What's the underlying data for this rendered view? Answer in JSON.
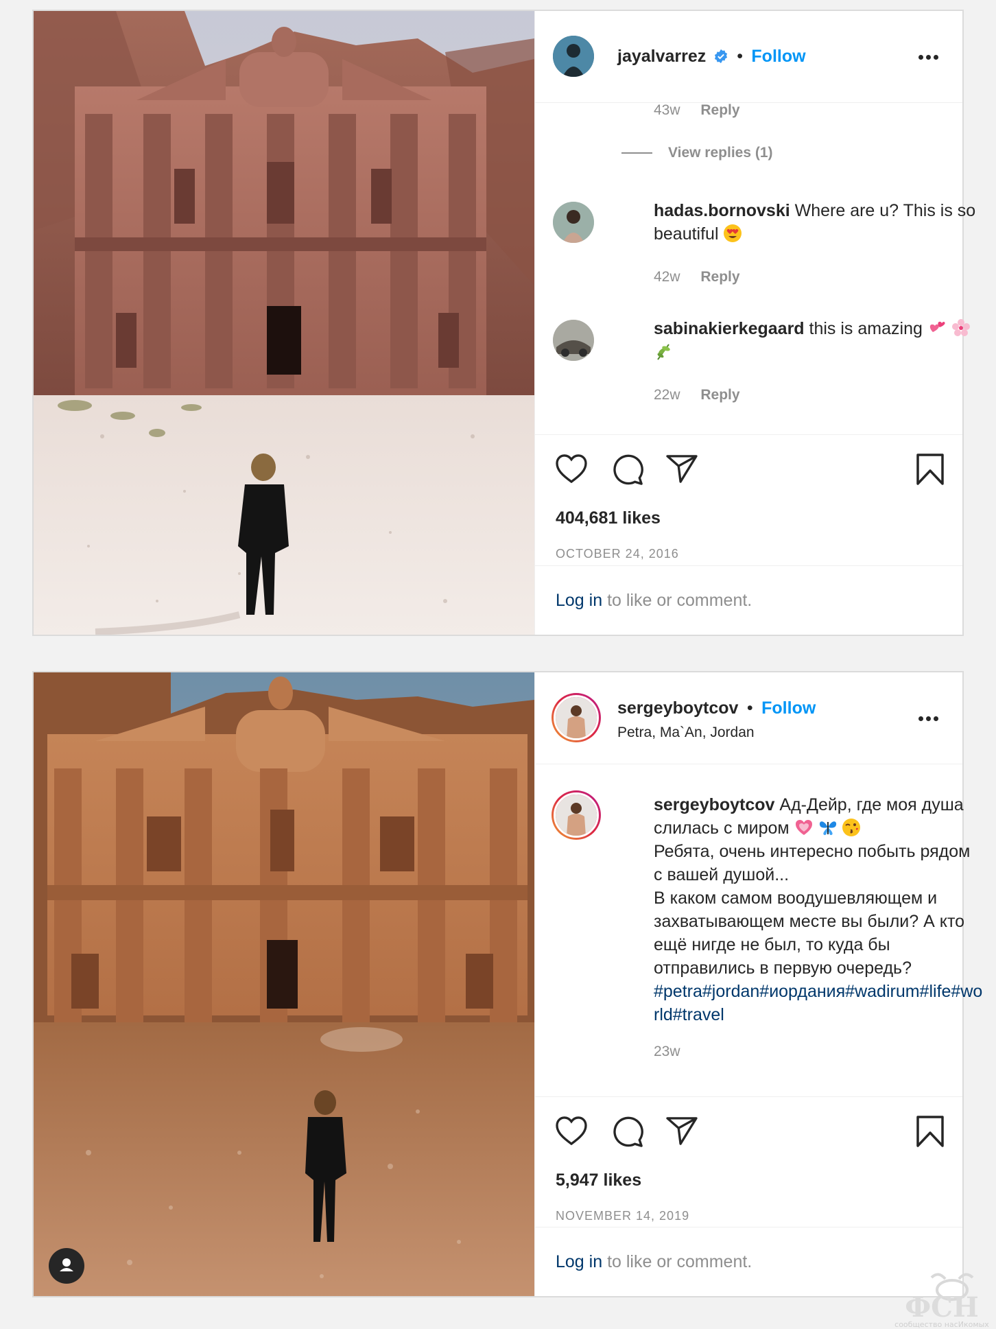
{
  "post1": {
    "username": "jayalvarrez",
    "follow_label": "Follow",
    "separator": "•",
    "comments": [
      {
        "time": "43w",
        "reply": "Reply"
      }
    ],
    "view_replies": "View replies (1)",
    "comment_items": [
      {
        "user": "hadas.bornovski",
        "text": "Where are u? This is so beautiful",
        "emojis": [
          "heart-eyes-emoji"
        ],
        "time": "42w",
        "reply": "Reply"
      },
      {
        "user": "sabinakierkegaard",
        "text": "this is amazing",
        "emojis": [
          "two-hearts-emoji",
          "cherry-blossom-emoji",
          "herb-emoji"
        ],
        "time": "22w",
        "reply": "Reply"
      }
    ],
    "likes": "404,681 likes",
    "date": "OCTOBER 24, 2016",
    "login_link": "Log in",
    "login_text": " to like or comment."
  },
  "post2": {
    "username": "sergeyboytcov",
    "follow_label": "Follow",
    "separator": "•",
    "location": "Petra, Ma`An, Jordan",
    "caption_user": "sergeyboytcov",
    "caption_line1": "Ад-Дейр, где моя душа слилась с миром",
    "caption_emojis": [
      "growing-heart-emoji",
      "butterfly-emoji",
      "kiss-emoji"
    ],
    "caption_line2": "Ребята, очень интересно побыть рядом с вашей душой...",
    "caption_line3": "В каком самом воодушевляющем и захватывающем месте вы были? А кто ещё нигде не был, то куда бы отправились в первую очередь?",
    "hashtags": "#petra#jordan#иордания#wadirum#life#world#travel",
    "time": "23w",
    "likes": "5,947 likes",
    "date": "NOVEMBER 14, 2019",
    "login_link": "Log in",
    "login_text": " to like or comment."
  },
  "watermark": {
    "logo": "ФСН",
    "text": "сообщество насИкомых"
  },
  "colors": {
    "follow": "#0095f6",
    "link": "#00376b",
    "muted": "#8e8e8e"
  }
}
